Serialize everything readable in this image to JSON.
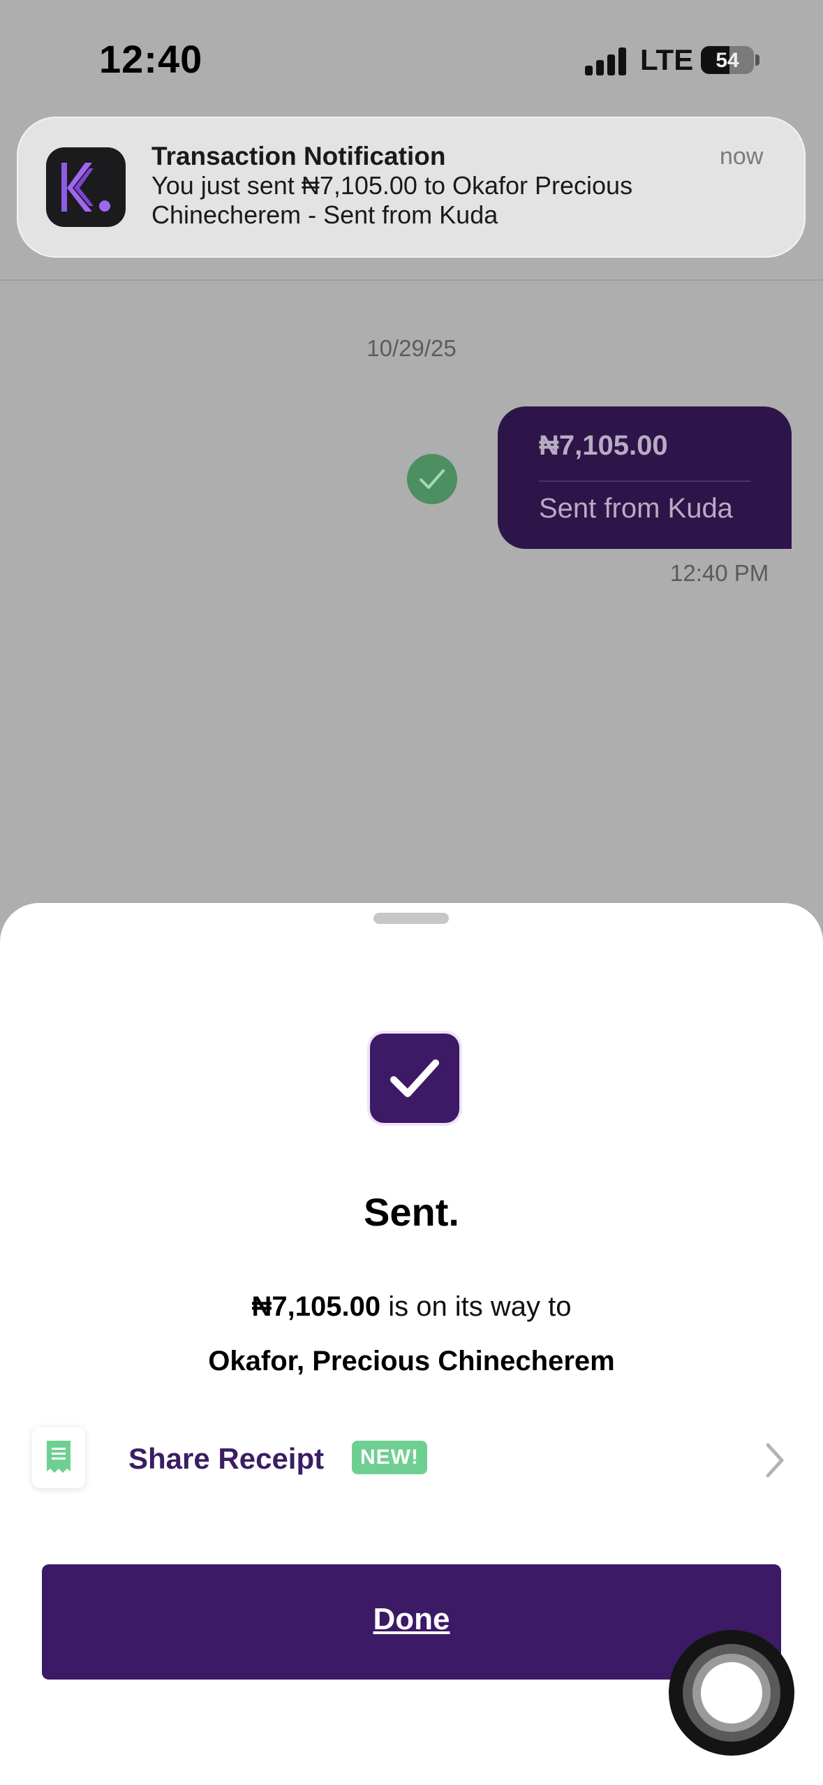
{
  "status_bar": {
    "time": "12:40",
    "network": "LTE",
    "battery": "54",
    "battery_level": 0.54
  },
  "notification": {
    "title": "Transaction Notification",
    "body": "You just sent ₦7,105.00 to Okafor  Precious Chinecherem - Sent from Kuda",
    "time": "now",
    "app_icon": "kuda-app-icon"
  },
  "chat": {
    "date": "10/29/25",
    "bubble_amount": "₦7,105.00",
    "bubble_note": "Sent from Kuda",
    "bubble_time": "12:40 PM"
  },
  "sheet": {
    "title": "Sent.",
    "amount": "₦7,105.00",
    "amount_suffix": " is on its way to",
    "recipient": "Okafor, Precious Chinecherem",
    "share_receipt_label": "Share Receipt",
    "new_badge": "NEW!",
    "done_label": "Done"
  },
  "colors": {
    "brand_purple": "#3c1a66",
    "badge_green": "#6fcf93",
    "check_green": "#4c8f60"
  }
}
